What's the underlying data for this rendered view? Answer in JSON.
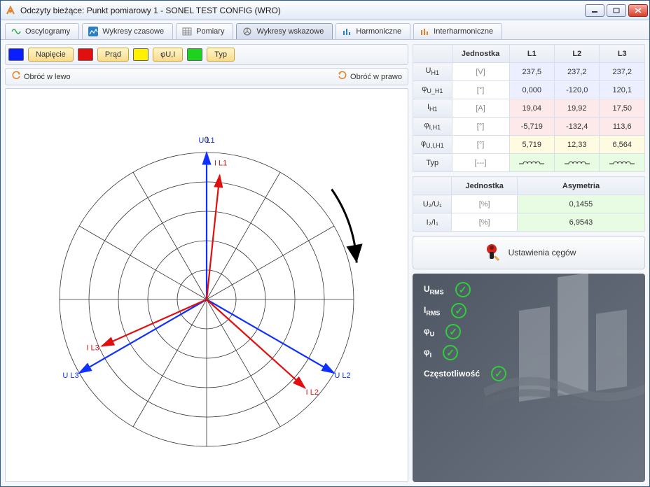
{
  "title": "Odczyty bieżące: Punkt pomiarowy 1 - SONEL TEST CONFIG (WRO)",
  "tabs": {
    "oscylogramy": "Oscylogramy",
    "wykresy_czasowe": "Wykresy czasowe",
    "pomiary": "Pomiary",
    "wykresy_wskazowe": "Wykresy wskazowe",
    "harmoniczne": "Harmoniczne",
    "interharmoniczne": "Interharmoniczne"
  },
  "legend": {
    "napiecie": "Napięcie",
    "prad": "Prąd",
    "phi": "φU,I",
    "typ": "Typ"
  },
  "rotate": {
    "left": "Obróć w lewo",
    "right": "Obróć w prawo"
  },
  "table1": {
    "headers": {
      "unit": "Jednostka",
      "L1": "L1",
      "L2": "L2",
      "L3": "L3"
    },
    "rows": {
      "UH1": {
        "label": "U",
        "sub": "H1",
        "unit": "[V]",
        "L1": "237,5",
        "L2": "237,2",
        "L3": "237,2"
      },
      "phiU": {
        "label": "φ",
        "sub": "U_H1",
        "unit": "[°]",
        "L1": "0,000",
        "L2": "-120,0",
        "L3": "120,1"
      },
      "IH1": {
        "label": "I",
        "sub": "H1",
        "unit": "[A]",
        "L1": "19,04",
        "L2": "19,92",
        "L3": "17,50"
      },
      "phiI": {
        "label": "φ",
        "sub": "I,H1",
        "unit": "[°]",
        "L1": "-5,719",
        "L2": "-132,4",
        "L3": "113,6"
      },
      "phiUI": {
        "label": "φ",
        "sub": "U,I,H1",
        "unit": "[°]",
        "L1": "5,719",
        "L2": "12,33",
        "L3": "6,564"
      },
      "typ": {
        "label": "Typ",
        "sub": "",
        "unit": "[---]"
      }
    }
  },
  "table2": {
    "headers": {
      "unit": "Jednostka",
      "asym": "Asymetria"
    },
    "rows": {
      "U": {
        "label": "U₂/U₁",
        "unit": "[%]",
        "val": "0,1455"
      },
      "I": {
        "label": "I₂/I₁",
        "unit": "[%]",
        "val": "6,9543"
      }
    }
  },
  "clamps_btn": "Ustawienia cęgów",
  "status": {
    "urms": "U",
    "urms_sub": "RMS",
    "irms": "I",
    "irms_sub": "RMS",
    "phiu": "φ",
    "phiu_sub": "U",
    "phii": "φ",
    "phii_sub": "I",
    "freq": "Częstotliwość"
  },
  "chart_data": {
    "type": "polar-phasor",
    "zero_label": "0",
    "vectors": [
      {
        "name": "U L1",
        "color": "#1030ff",
        "angle_deg": 0,
        "mag": 1.0
      },
      {
        "name": "I L1",
        "color": "#e01010",
        "angle_deg": 6,
        "mag": 0.85
      },
      {
        "name": "U L2",
        "color": "#1030ff",
        "angle_deg": 120,
        "mag": 1.0
      },
      {
        "name": "I L2",
        "color": "#e01010",
        "angle_deg": 132,
        "mag": 0.9
      },
      {
        "name": "U L3",
        "color": "#1030ff",
        "angle_deg": -120,
        "mag": 1.0
      },
      {
        "name": "I L3",
        "color": "#e01010",
        "angle_deg": -114,
        "mag": 0.78
      }
    ],
    "labels": {
      "UL1": "U L1",
      "IL1": "I L1",
      "UL2": "U L2",
      "IL2": "I L2",
      "UL3": "U L3",
      "IL3": "I L3"
    }
  }
}
